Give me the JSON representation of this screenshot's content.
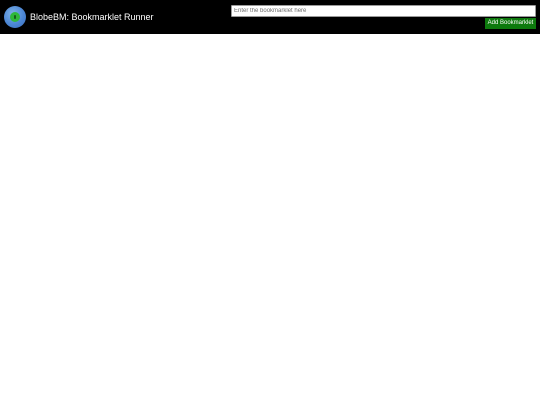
{
  "header": {
    "app_title": "BlobeBM: Bookmarklet Runner",
    "logo_icon": "globe-logo-icon"
  },
  "bookmarklet": {
    "input_value": "",
    "input_placeholder": "Enter the bookmarklet here",
    "add_button_label": "Add Bookmarklet"
  },
  "colors": {
    "header_background": "#000000",
    "button_background": "#0d7a0d",
    "page_background": "#ffffff"
  }
}
